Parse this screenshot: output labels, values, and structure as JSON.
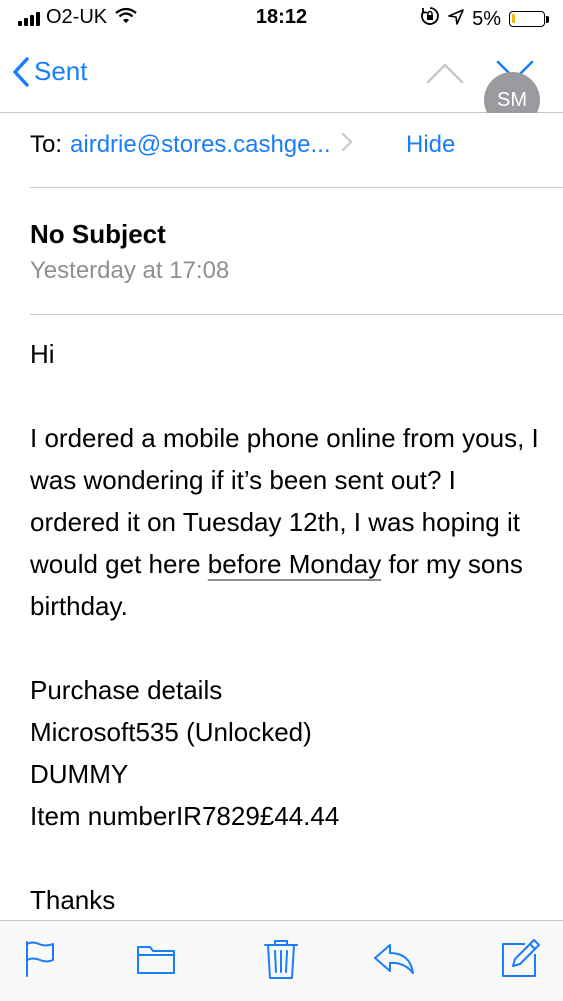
{
  "status_bar": {
    "carrier": "O2-UK",
    "time": "18:12",
    "battery_percent": "5%",
    "icons": [
      "signal-icon",
      "wifi-icon",
      "rotation-lock-icon",
      "location-icon",
      "battery-icon"
    ]
  },
  "nav": {
    "back_label": "Sent",
    "icons": [
      "chevron-left-icon",
      "chevron-up-icon",
      "chevron-down-icon"
    ]
  },
  "email": {
    "avatar_initials": "SM",
    "to_label": "To:",
    "to_address": "airdrie@stores.cashge...",
    "hide_label": "Hide",
    "subject": "No Subject",
    "date": "Yesterday at 17:08",
    "greeting": "Hi",
    "paragraph_part1": "I ordered a mobile phone online from yous, I was wondering if it’s been sent out? I ordered it on Tuesday 12th, I was hoping it would get here ",
    "paragraph_link": "before Monday",
    "paragraph_part2": " for my sons birthday.",
    "details_heading": "Purchase details",
    "details_line1": "Microsoft535 (Unlocked)",
    "details_line2": "DUMMY",
    "details_line3": "Item numberIR7829£44.44",
    "closing": "Thanks"
  },
  "toolbar": {
    "icons": [
      "flag-icon",
      "folder-icon",
      "trash-icon",
      "reply-icon",
      "compose-icon"
    ]
  },
  "colors": {
    "accent": "#1a7dfa",
    "secondary_text": "#8e8e93",
    "separator": "#c8c7cc",
    "battery_low": "#f0b90b"
  }
}
